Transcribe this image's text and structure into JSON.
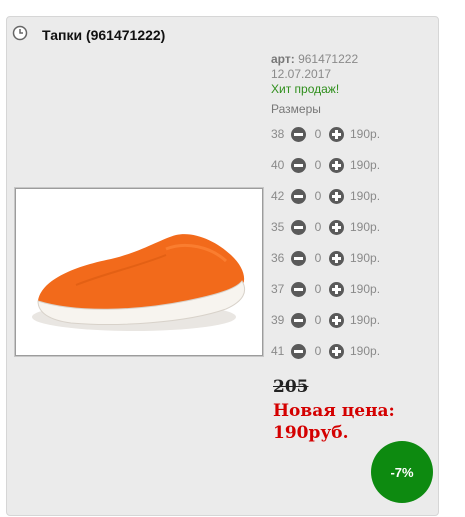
{
  "product": {
    "title": "Тапки (961471222)",
    "art_label": "арт:",
    "art_value": "961471222",
    "date": "12.07.2017",
    "badge": "Хит продаж!",
    "image_icon": "slipper-image",
    "clock_icon": "clock-icon"
  },
  "sizes": {
    "title": "Размеры",
    "rows": [
      {
        "size": "38",
        "qty": "0",
        "price": "190р."
      },
      {
        "size": "40",
        "qty": "0",
        "price": "190р."
      },
      {
        "size": "42",
        "qty": "0",
        "price": "190р."
      },
      {
        "size": "35",
        "qty": "0",
        "price": "190р."
      },
      {
        "size": "36",
        "qty": "0",
        "price": "190р."
      },
      {
        "size": "37",
        "qty": "0",
        "price": "190р."
      },
      {
        "size": "39",
        "qty": "0",
        "price": "190р."
      },
      {
        "size": "41",
        "qty": "0",
        "price": "190р."
      }
    ]
  },
  "pricing": {
    "old_price": "205",
    "new_price_label": "Новая цена:",
    "new_price_value": "190руб.",
    "discount": "-7%"
  },
  "colors": {
    "accent_red": "#d40000",
    "discount_green": "#0d8a10",
    "hit_green": "#2f8f1c",
    "slipper_orange": "#f26a1b"
  }
}
